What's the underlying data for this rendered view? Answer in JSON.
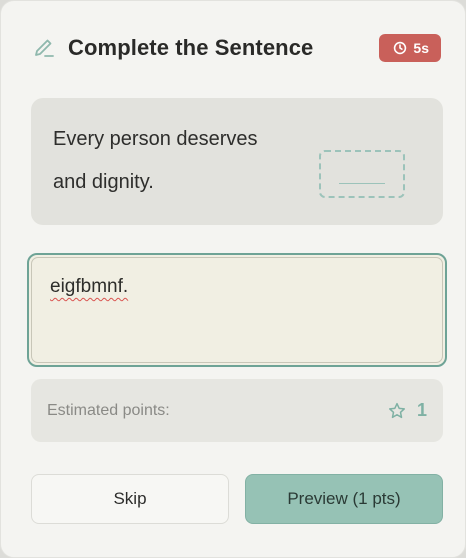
{
  "header": {
    "title": "Complete the Sentence",
    "icon": "pencil-icon",
    "timer": {
      "icon": "clock-icon",
      "label": "5s",
      "color": "#c9605a"
    }
  },
  "sentence": {
    "part1": "Every person deserves",
    "blank_icon": "blank-placeholder",
    "part2": "and dignity."
  },
  "answer": {
    "value": "eigfbmnf."
  },
  "points": {
    "label": "Estimated points:",
    "icon": "star-icon",
    "value": "1"
  },
  "actions": {
    "skip_label": "Skip",
    "preview_label": "Preview (1 pts)"
  },
  "colors": {
    "accent": "#96c2b5",
    "focus_border": "#6ea396",
    "timer_bg": "#c9605a"
  }
}
